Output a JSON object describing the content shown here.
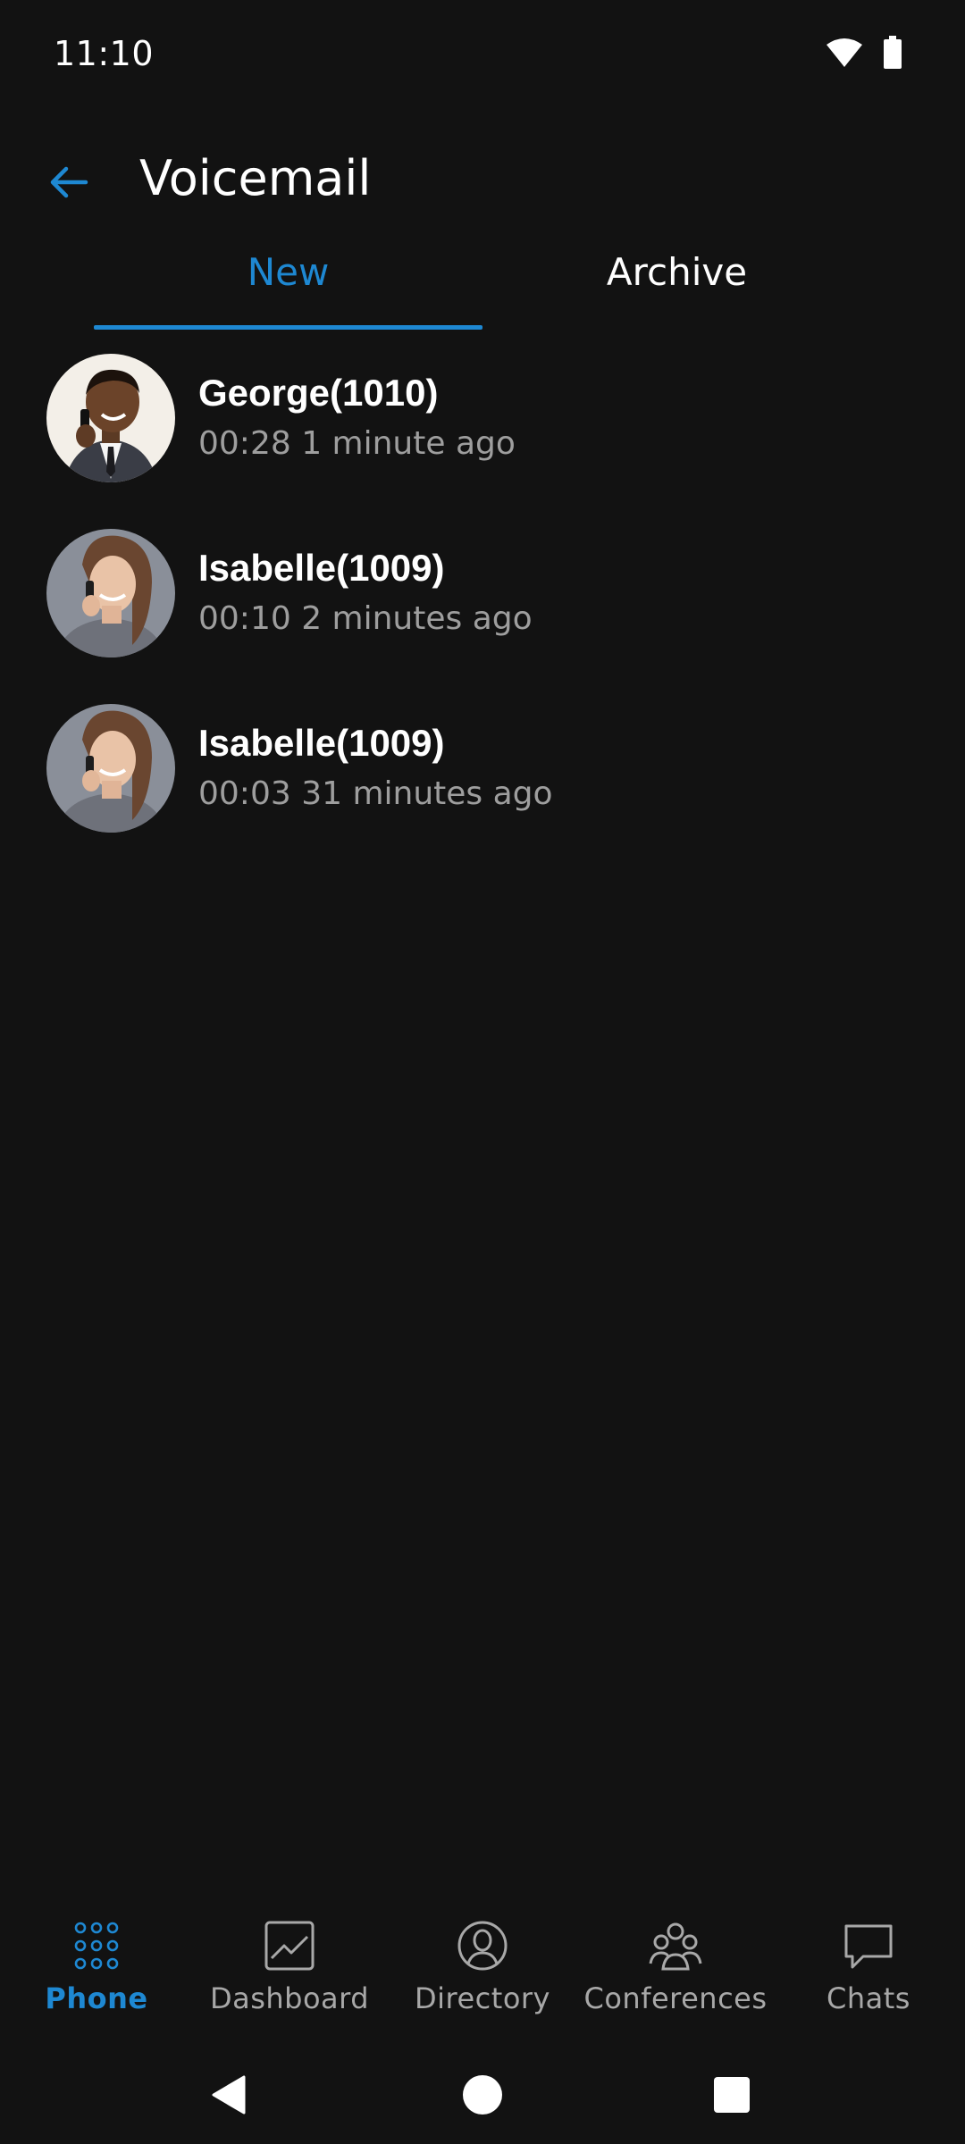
{
  "status_bar": {
    "time": "11:10",
    "icons": [
      "wifi-icon",
      "battery-icon"
    ]
  },
  "header": {
    "back_icon": "arrow-left-icon",
    "title": "Voicemail"
  },
  "tabs": [
    {
      "label": "New",
      "active": true
    },
    {
      "label": "Archive",
      "active": false
    }
  ],
  "voicemails": [
    {
      "name": "George(1010)",
      "meta": "00:28 1 minute ago",
      "avatar": "man-on-phone"
    },
    {
      "name": "Isabelle(1009)",
      "meta": "00:10 2 minutes ago",
      "avatar": "woman-on-phone"
    },
    {
      "name": "Isabelle(1009)",
      "meta": "00:03 31 minutes ago",
      "avatar": "woman-on-phone"
    }
  ],
  "bottom_nav": [
    {
      "label": "Phone",
      "icon": "dialpad-icon",
      "active": true
    },
    {
      "label": "Dashboard",
      "icon": "chart-icon",
      "active": false
    },
    {
      "label": "Directory",
      "icon": "person-icon",
      "active": false
    },
    {
      "label": "Conferences",
      "icon": "group-icon",
      "active": false
    },
    {
      "label": "Chats",
      "icon": "chat-bubble-icon",
      "active": false
    }
  ],
  "colors": {
    "accent": "#1e88d2",
    "background": "#121212",
    "text_primary": "#ffffff",
    "text_secondary": "#9e9e9e"
  }
}
